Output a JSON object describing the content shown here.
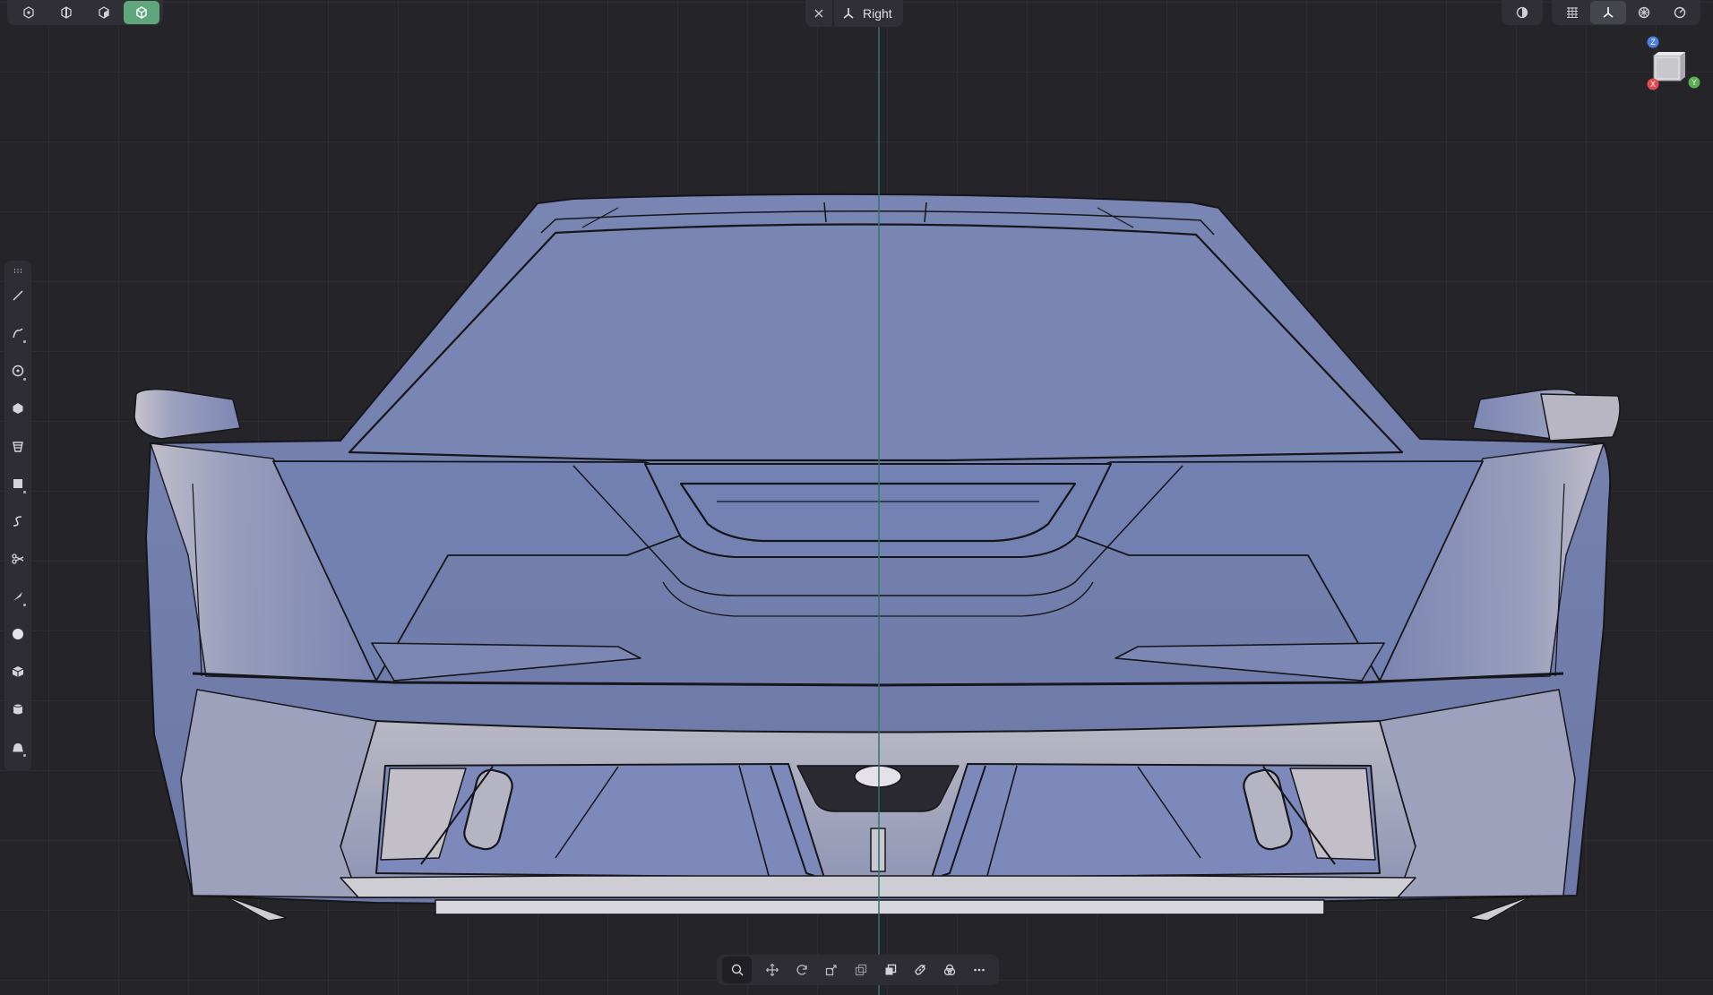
{
  "top_left_modes": [
    {
      "name": "mode-vertex",
      "icon": "vertex-icon"
    },
    {
      "name": "mode-edge",
      "icon": "edge-icon"
    },
    {
      "name": "mode-face",
      "icon": "face-icon"
    },
    {
      "name": "mode-object",
      "icon": "object-icon",
      "active": true
    }
  ],
  "view_selector": {
    "close_icon": "close-icon",
    "axis_icon": "axis-icon",
    "label": "Right"
  },
  "top_right_tools": [
    {
      "name": "shading-mode",
      "icon": "half-circle-icon"
    },
    {
      "name": "grid-toggle",
      "icon": "grid-icon"
    },
    {
      "name": "axes-toggle",
      "icon": "axis-icon",
      "active": true
    },
    {
      "name": "snapping",
      "icon": "snap-icon"
    },
    {
      "name": "render-settings",
      "icon": "circle-icon"
    }
  ],
  "nav_cube": {
    "z": "Z",
    "x": "X",
    "y": "Y",
    "colors": {
      "z": "#4a7fe0",
      "x": "#e24b4b",
      "y": "#56b04f"
    }
  },
  "left_tools": [
    "line-tool-icon",
    "curve-tool-icon",
    "circle-tool-icon",
    "polygon-tool-icon",
    "extrude-tool-icon",
    "rectangle-tool-icon",
    "spline-tool-icon",
    "scissors-tool-icon",
    "knife-tool-icon",
    "sphere-tool-icon",
    "box-tool-icon",
    "cylinder-tool-icon",
    "loft-tool-icon"
  ],
  "bottom_tools": [
    "zoom-icon",
    "move-icon",
    "rotate-icon",
    "scale-icon",
    "duplicate-icon",
    "boolean-icon",
    "link-icon",
    "combine-icon",
    "more-icon"
  ],
  "colors": {
    "accent": "#5fa67c",
    "background": "#242429",
    "panel": "#2f2f35",
    "model": "#7683b0",
    "axis_line": "#3a8f88"
  }
}
